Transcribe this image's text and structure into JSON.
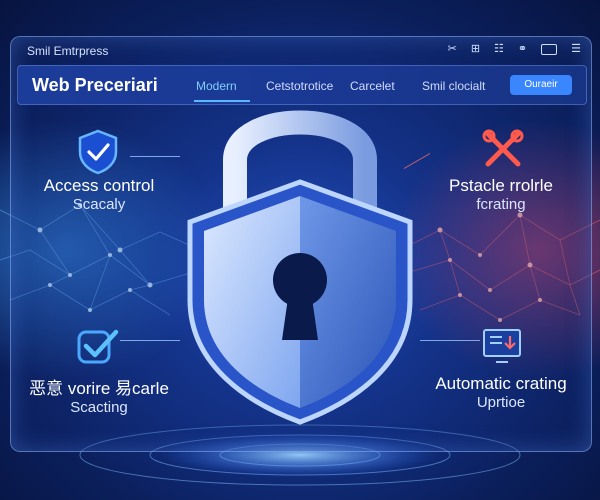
{
  "window": {
    "app_title": "Smil Emtrpress",
    "brand": "Web Preceriari"
  },
  "nav": {
    "tabs": [
      {
        "label": "Modern",
        "active": true
      },
      {
        "label": "Cetstotrotice",
        "active": false
      },
      {
        "label": "Carcelet",
        "active": false
      },
      {
        "label": "Smil clocialt",
        "active": false
      }
    ],
    "cta": "Ouraeir"
  },
  "features": {
    "top_left": {
      "line1": "Access control",
      "line2": "Scacaly",
      "icon": "shield-check-icon"
    },
    "top_right": {
      "line1": "Pstacle rrolrle",
      "line2": "fcrating",
      "icon": "crossed-tools-icon"
    },
    "bottom_left": {
      "line1": "恶意 vorire 易carle",
      "line2": "Scacting",
      "icon": "checkmark-icon"
    },
    "bottom_right": {
      "line1": "Automatic crating",
      "line2": "Uprtioe",
      "icon": "monitor-download-icon"
    }
  },
  "colors": {
    "accent": "#3a86ff",
    "active_tab": "#7fd0ff",
    "alert": "#ff5a4d",
    "background": "#14358f"
  }
}
